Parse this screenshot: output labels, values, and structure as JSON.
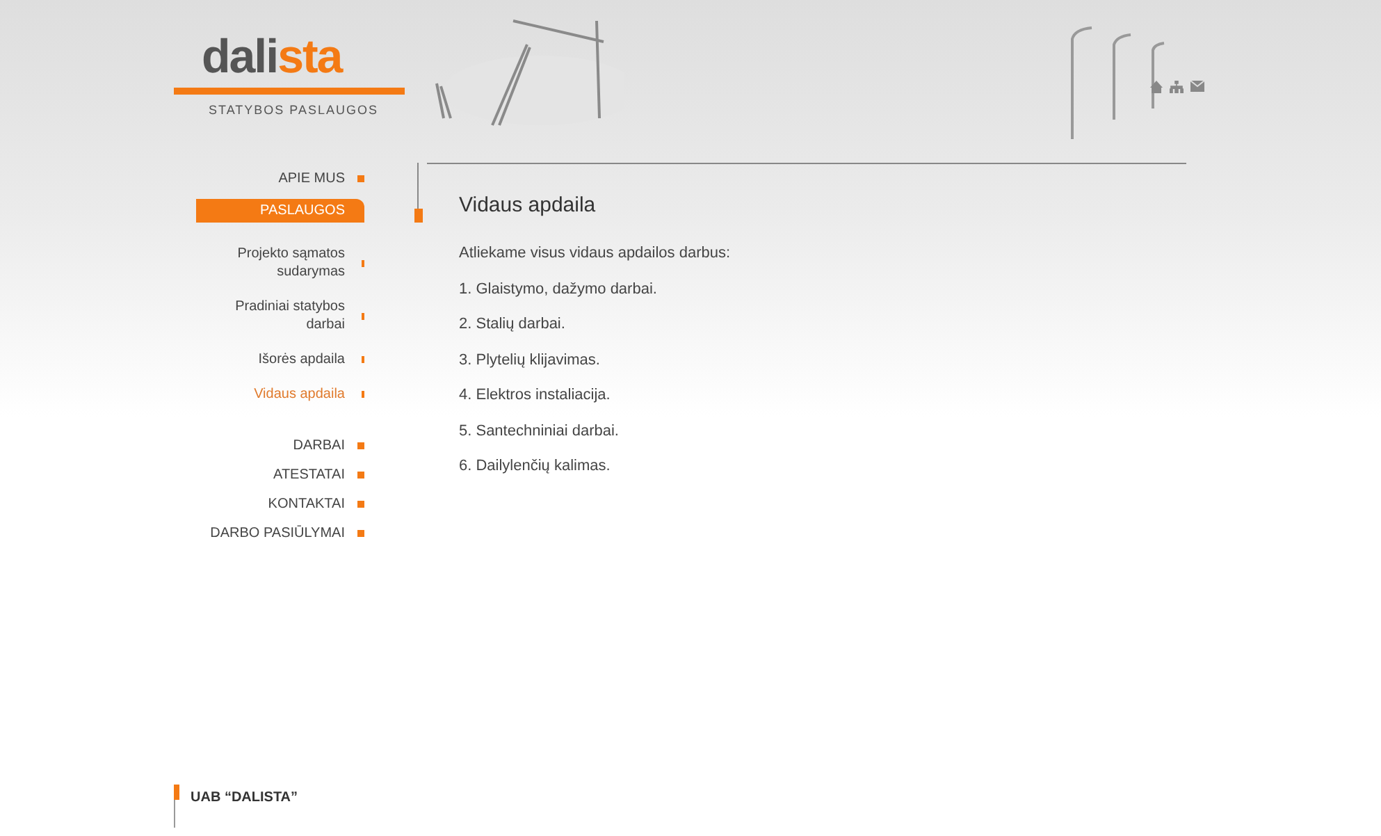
{
  "logo": {
    "dark_part": "dali",
    "accent_part": "sta",
    "tagline": "STATYBOS PASLAUGOS"
  },
  "menu": [
    {
      "kind": "main",
      "label": "APIE MUS",
      "selected": false
    },
    {
      "kind": "main",
      "label": "PASLAUGOS",
      "selected": true
    },
    {
      "kind": "sub",
      "label": "Projekto sąmatos sudarymas",
      "selected": false
    },
    {
      "kind": "sub",
      "label": "Pradiniai statybos darbai",
      "selected": false
    },
    {
      "kind": "sub",
      "label": "Išorės apdaila",
      "selected": false
    },
    {
      "kind": "sub",
      "label": "Vidaus apdaila",
      "selected": true
    },
    {
      "kind": "main",
      "label": "DARBAI",
      "selected": false
    },
    {
      "kind": "main",
      "label": "ATESTATAI",
      "selected": false
    },
    {
      "kind": "main",
      "label": "KONTAKTAI",
      "selected": false
    },
    {
      "kind": "main",
      "label": "DARBO PASIŪLYMAI",
      "selected": false
    }
  ],
  "content": {
    "title": "Vidaus apdaila",
    "intro": "Atliekame visus vidaus apdailos darbus:",
    "items": [
      "1. Glaistymo, dažymo darbai.",
      "2. Stalių darbai.",
      "3. Plytelių klijavimas.",
      "4. Elektros instaliacija.",
      "5. Santechniniai darbai.",
      "6. Dailylenčių kalimas."
    ]
  },
  "footer": {
    "company": "UAB “DALISTA”"
  }
}
